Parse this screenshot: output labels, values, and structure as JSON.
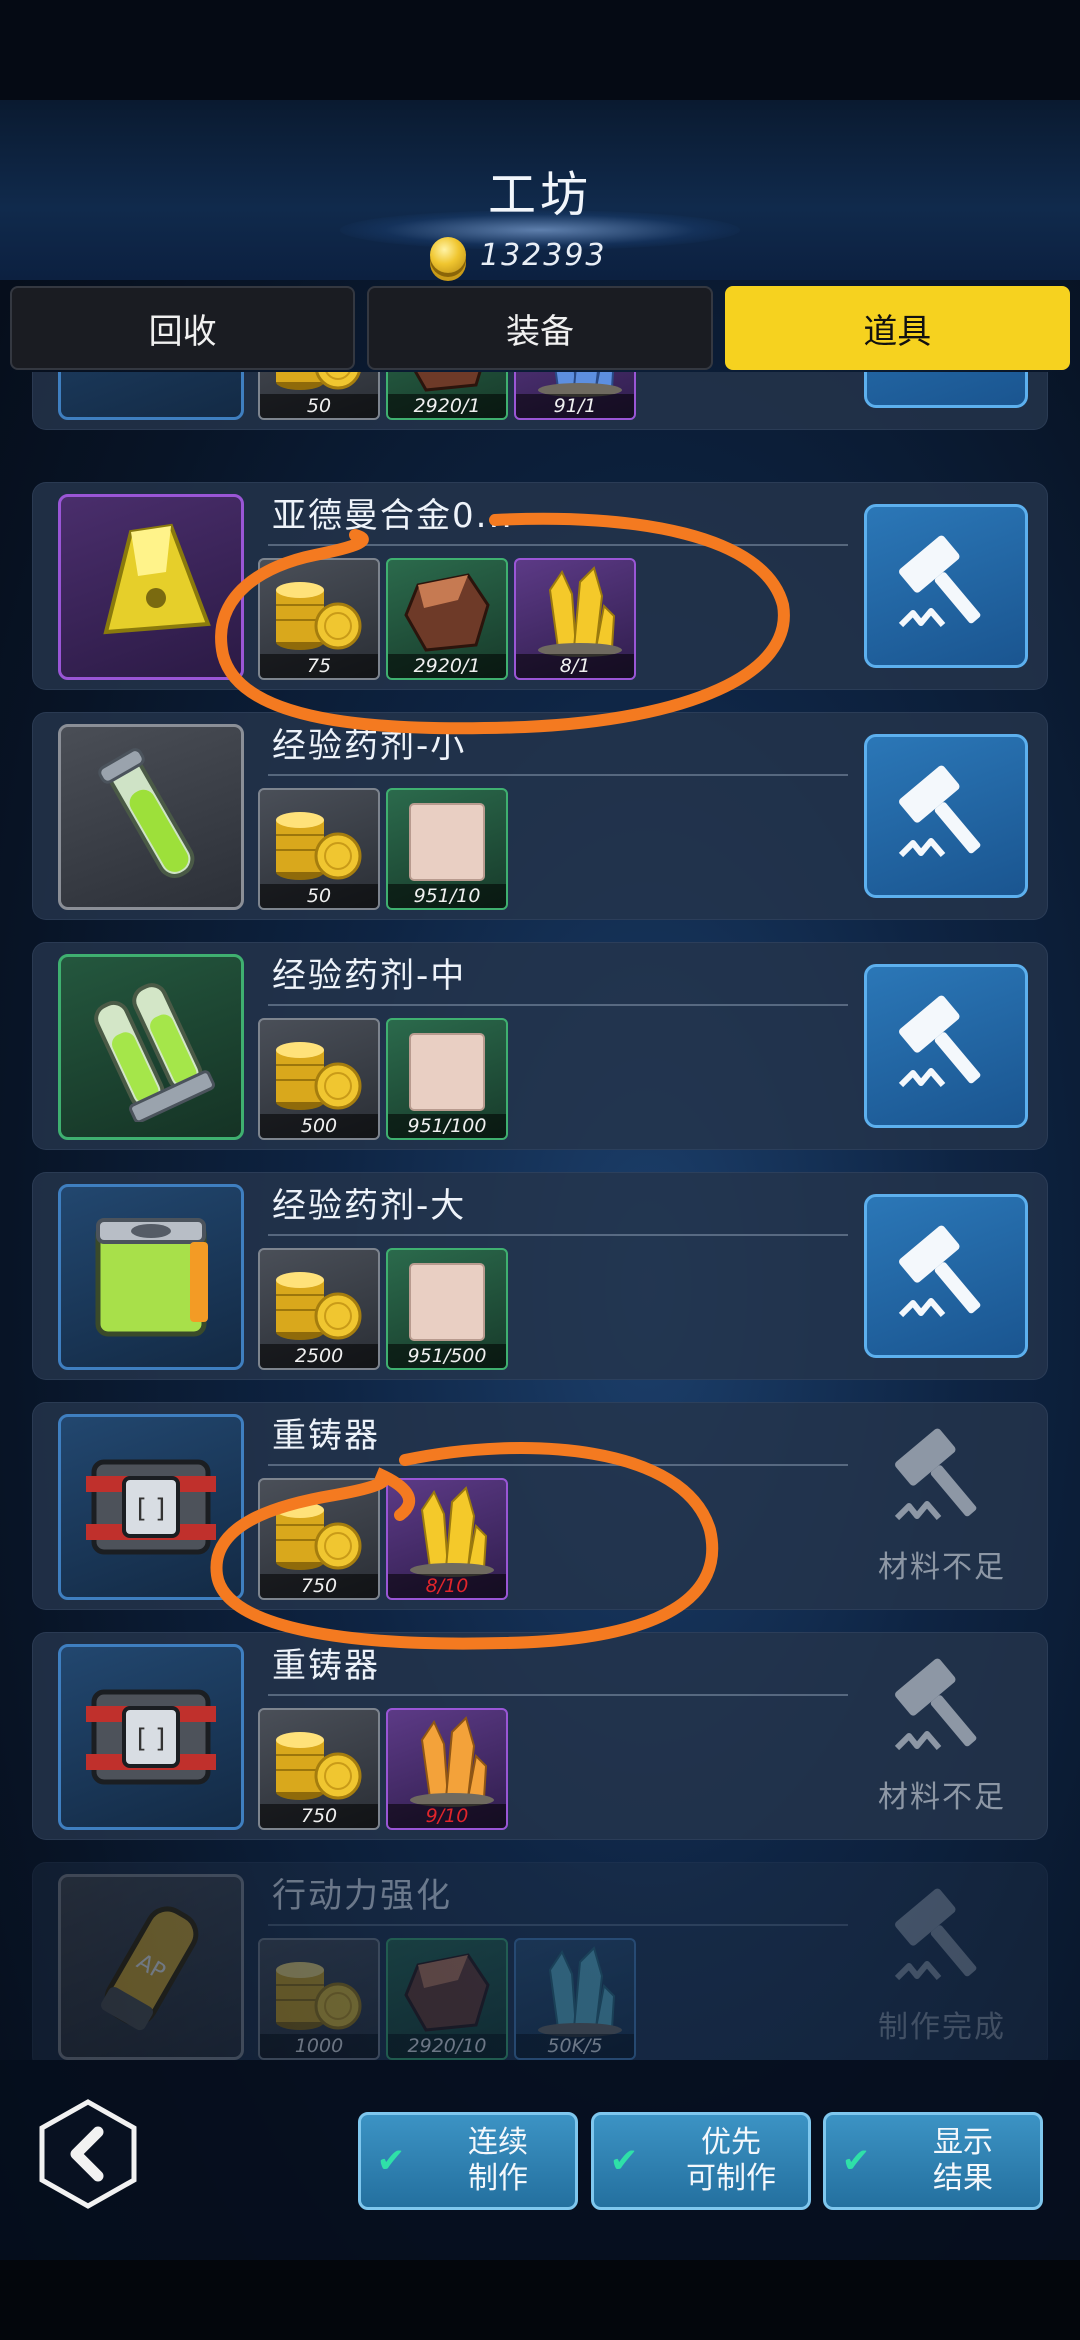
{
  "header": {
    "title": "工坊",
    "coin_count": "132393"
  },
  "tabs": [
    {
      "label": "回收",
      "active": false
    },
    {
      "label": "装备",
      "active": false
    },
    {
      "label": "道具",
      "active": true
    }
  ],
  "rows": [
    {
      "name": "",
      "materials": [
        {
          "kind": "coin",
          "count": "50"
        },
        {
          "kind": "ore",
          "count": "2920/1"
        },
        {
          "kind": "crystal-blue",
          "count": "91/1"
        }
      ],
      "craft": {
        "state": "ready",
        "label": ""
      }
    },
    {
      "name": "亚德曼合金0...",
      "materials": [
        {
          "kind": "coin",
          "count": "75"
        },
        {
          "kind": "ore",
          "count": "2920/1"
        },
        {
          "kind": "crystal-yellow",
          "count": "8/1"
        }
      ],
      "craft": {
        "state": "ready",
        "label": ""
      }
    },
    {
      "name": "经验药剂-小",
      "materials": [
        {
          "kind": "coin",
          "count": "50"
        },
        {
          "kind": "cube",
          "count": "951/10"
        }
      ],
      "craft": {
        "state": "ready",
        "label": ""
      }
    },
    {
      "name": "经验药剂-中",
      "materials": [
        {
          "kind": "coin",
          "count": "500"
        },
        {
          "kind": "cube",
          "count": "951/100"
        }
      ],
      "craft": {
        "state": "ready",
        "label": ""
      }
    },
    {
      "name": "经验药剂-大",
      "materials": [
        {
          "kind": "coin",
          "count": "2500"
        },
        {
          "kind": "cube",
          "count": "951/500"
        }
      ],
      "craft": {
        "state": "ready",
        "label": ""
      }
    },
    {
      "name": "重铸器",
      "materials": [
        {
          "kind": "coin",
          "count": "750"
        },
        {
          "kind": "crystal-yellow",
          "count": "8/10"
        }
      ],
      "craft": {
        "state": "disabled",
        "label": "材料不足"
      }
    },
    {
      "name": "重铸器",
      "materials": [
        {
          "kind": "coin",
          "count": "750"
        },
        {
          "kind": "crystal-orange",
          "count": "9/10"
        }
      ],
      "craft": {
        "state": "disabled",
        "label": "材料不足"
      }
    },
    {
      "name": "行动力强化",
      "materials": [
        {
          "kind": "coin",
          "count": "1000"
        },
        {
          "kind": "ore",
          "count": "2920/10"
        },
        {
          "kind": "crystal-teal",
          "count": "50K/5"
        }
      ],
      "craft": {
        "state": "done",
        "label": "制作完成"
      }
    }
  ],
  "options": [
    {
      "line1": "连续",
      "line2": "制作",
      "checked": true
    },
    {
      "line1": "优先",
      "line2": "可制作",
      "checked": true
    },
    {
      "line1": "显示",
      "line2": "结果",
      "checked": true
    }
  ],
  "colors": {
    "accent_yellow": "#f6d21f",
    "craft_blue": "#2b77b7",
    "shortage_red": "#e0252b",
    "annotation_orange": "#f47a20"
  }
}
